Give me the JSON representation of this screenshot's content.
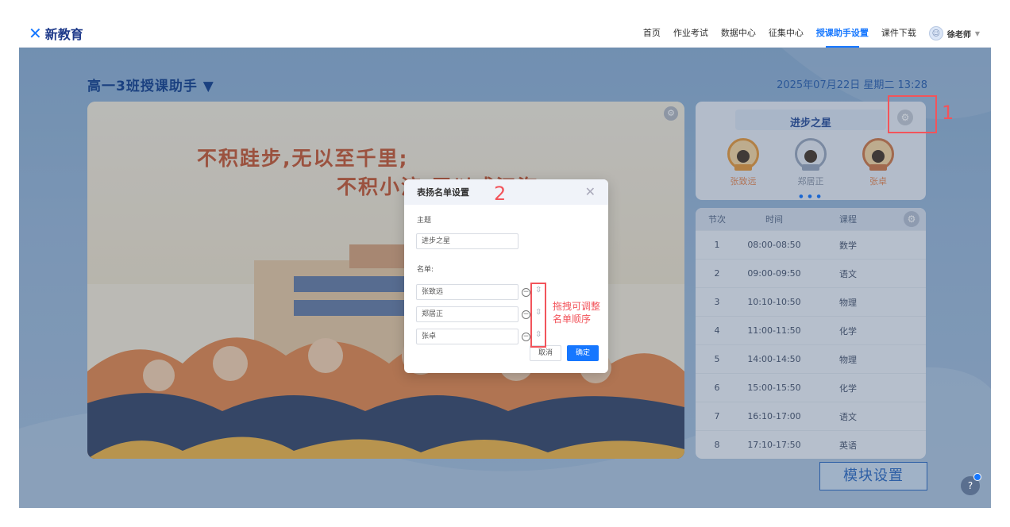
{
  "nav": {
    "logo_text": "新教育",
    "links": [
      "首页",
      "作业考试",
      "数据中心",
      "征集中心",
      "授课助手设置",
      "课件下载"
    ],
    "active_index": 4,
    "user_name": "徐老师"
  },
  "header": {
    "class_title": "高一3班授课助手 ▼",
    "datetime": "2025年07月22日 星期二  13:28"
  },
  "banner": {
    "quote_line1": "不积跬步,无以至千里;",
    "quote_line2": "不积小流,无以成江海"
  },
  "star_card": {
    "title": "进步之星",
    "students": [
      "张致远",
      "郑居正",
      "张卓"
    ]
  },
  "schedule": {
    "headers": [
      "节次",
      "时间",
      "课程"
    ],
    "rows": [
      [
        "1",
        "08:00-08:50",
        "数学"
      ],
      [
        "2",
        "09:00-09:50",
        "语文"
      ],
      [
        "3",
        "10:10-10:50",
        "物理"
      ],
      [
        "4",
        "11:00-11:50",
        "化学"
      ],
      [
        "5",
        "14:00-14:50",
        "物理"
      ],
      [
        "6",
        "15:00-15:50",
        "化学"
      ],
      [
        "7",
        "16:10-17:00",
        "语文"
      ],
      [
        "8",
        "17:10-17:50",
        "英语"
      ]
    ]
  },
  "module_button": "模块设置",
  "help_label": "?",
  "annotations": {
    "num1": "1",
    "num2": "2",
    "drag_hint": "拖拽可调整名单顺序"
  },
  "modal": {
    "title": "表扬名单设置",
    "topic_label": "主题",
    "topic_value": "进步之星",
    "list_label": "名单:",
    "names": [
      "张致远",
      "郑居正",
      "张卓"
    ],
    "cancel_label": "取消",
    "ok_label": "确定"
  },
  "colors": {
    "accent": "#1677ff",
    "annotation": "#f2545b",
    "quote": "#c85a35"
  }
}
